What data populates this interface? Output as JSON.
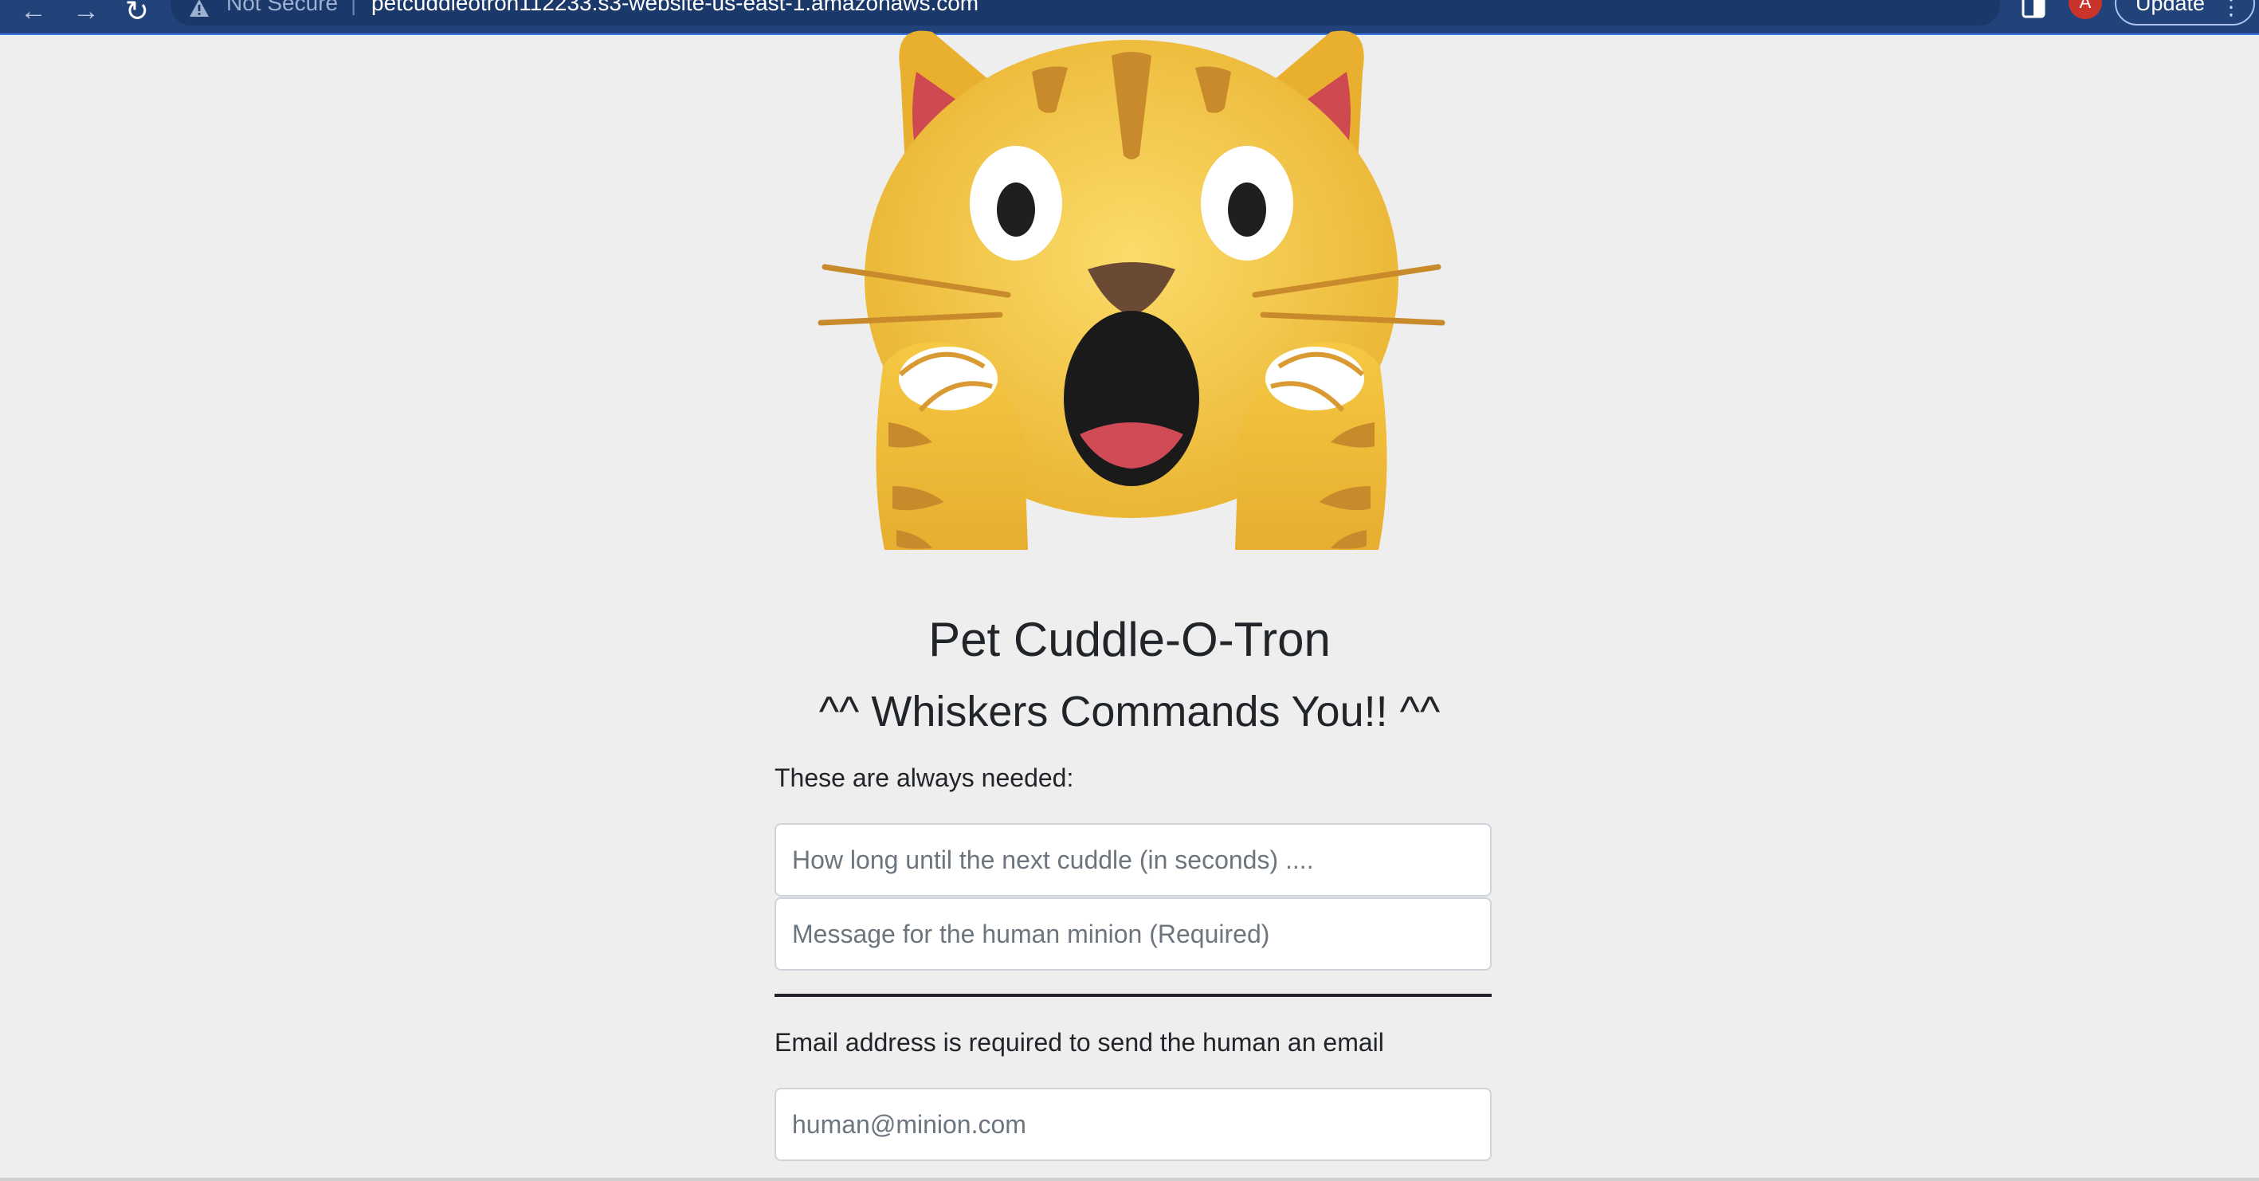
{
  "browser": {
    "security_label": "Not Secure",
    "url": "petcuddleotron112233.s3-website-us-east-1.amazonaws.com",
    "avatar_letter": "A",
    "update_label": "Update",
    "icons": {
      "back": "arrow-left-icon",
      "forward": "arrow-right-icon",
      "reload": "reload-icon",
      "security": "warning-triangle-icon",
      "share": "share-icon",
      "bookmark": "star-icon",
      "side_panel": "side-panel-icon",
      "menu": "kebab-menu-icon"
    },
    "colors": {
      "toolbar": "#22437a",
      "omnibox": "#1b386b",
      "avatar": "#c9332a"
    }
  },
  "page": {
    "hero_image": "weary-cat-face-emoji",
    "title": "Pet Cuddle-O-Tron",
    "subtitle": "^^ Whiskers Commands You!! ^^",
    "always_needed_text": "These are always needed:",
    "cuddle_placeholder": "How long until the next cuddle (in seconds) ....",
    "cuddle_value": "",
    "message_placeholder": "Message for the human minion (Required)",
    "message_value": "",
    "email_help_text": "Email address is required to send the human an email",
    "email_placeholder": "human@minion.com",
    "email_value": "",
    "colors": {
      "background": "#eeeeee",
      "text": "#212529",
      "placeholder": "#6c757d",
      "field_border": "#ced4da"
    }
  }
}
